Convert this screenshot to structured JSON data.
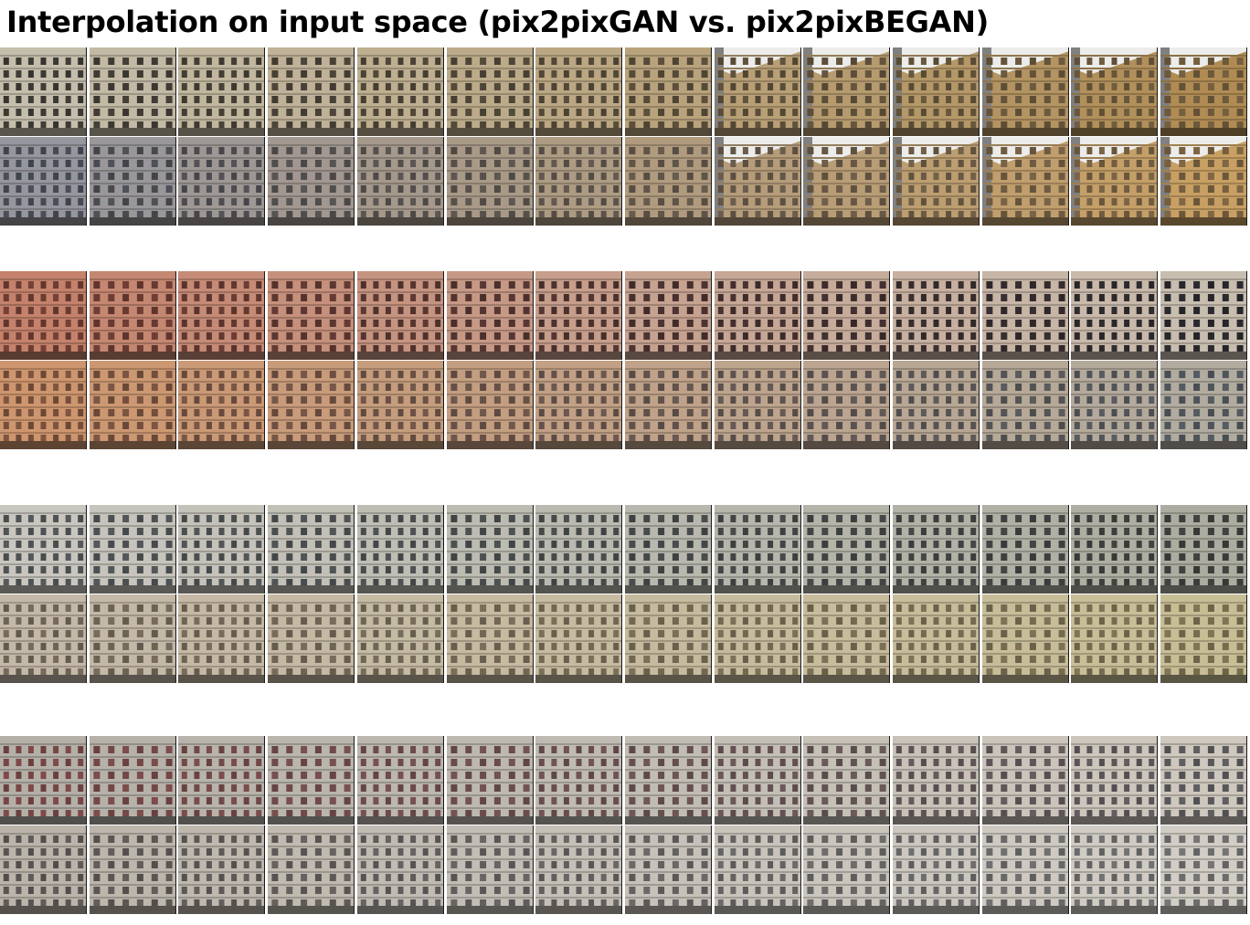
{
  "title": "Interpolation on input space (pix2pixGAN vs. pix2pixBEGAN)",
  "figure": {
    "blocks": 4,
    "rows_per_block": 2,
    "steps_per_row": 14,
    "row_models": [
      "pix2pixGAN",
      "pix2pixBEGAN"
    ]
  },
  "colors": {
    "background": "#ffffff",
    "tile_border": "#1a1a1a"
  }
}
